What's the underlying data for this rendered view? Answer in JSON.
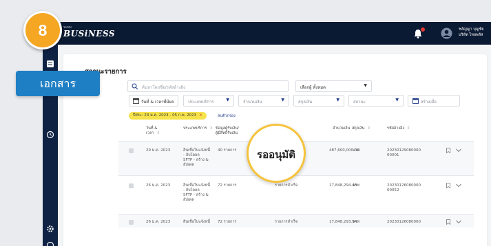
{
  "app": {
    "logo_prefix": "ระบบ",
    "logo": "BUSiNESS",
    "user_name_line1": "ชลัญญา บุญชัย",
    "user_name_line2": "บริษัท ไทยพลัส"
  },
  "badge": {
    "step_number": "8"
  },
  "annotation": {
    "menu_label": "เอกสาร",
    "callout_text": "รออนุมัติ"
  },
  "page": {
    "title": "สถานะรายการ"
  },
  "filters": {
    "search_placeholder": "ค้นหาโดยชื่อ/รหัสอ้างอิง",
    "account_select": "เลือกผู้ ทั้งหมด",
    "date_button": "วันที่ & เวลาที่มีผล",
    "service_type": "ประเภทบริการ",
    "amount": "จำนวนเงิน",
    "currency": "สกุลเงิน",
    "status": "สถานะ",
    "created_date": "สร้างเมื่อ",
    "active_chip": "ปีสระ: 23 ม.ค. 2023 - 05 ก.พ. 2023",
    "chip_close": "✕",
    "clear_label": "ลบตัวกรอง"
  },
  "table": {
    "headers": [
      "วันที่ &\nเวลา",
      "ประเภทบริการ",
      "ข้อมูลผู้รับเงิน/\nผู้มีสิทธิ์รับเงิน",
      "",
      "จำนวนเงิน",
      "สกุลเงิน",
      "รหัสอ้างอิง"
    ],
    "rows": [
      {
        "date": "29 ม.ค. 2023",
        "service": [
          "สินเชื่อใบแจ้งหนี้",
          "- ลับโดยล",
          "SFTP - สร้าง &",
          "อัปเดต"
        ],
        "payee": "40 รายการ",
        "status": "",
        "amount": "487,600,000.00",
        "currency": "บาท",
        "ref": [
          "20230129080000",
          "00001"
        ]
      },
      {
        "date": "26 ม.ค. 2023",
        "service": [
          "สินเชื่อใบแจ้งหนี้",
          "- ลับโดยล",
          "SFTP - สร้าง &",
          "อัปเดต"
        ],
        "payee": "72 รายการ",
        "status": "รายการสำเร็จ",
        "amount": "17,848,294.48",
        "currency": "บาท",
        "ref": [
          "20230126080000",
          "00052"
        ]
      },
      {
        "date": "26 ม.ค. 2023",
        "service": [
          "สินเชื่อใบแจ้งหนี้"
        ],
        "payee": "72 รายการ",
        "status": "รายการสำเร็จ",
        "amount": "17,848,293.94",
        "currency": "บาท",
        "ref": [
          "20230126080000"
        ]
      }
    ]
  },
  "colors": {
    "topbar": "#0b1a33",
    "accent_blue": "#1f7fc4",
    "badge_orange": "#f5a623",
    "chip_yellow": "#f6e34c"
  },
  "icons": [
    "search-icon",
    "calendar-icon",
    "bell-icon",
    "user-icon",
    "document-icon",
    "clock-icon",
    "settings-icon",
    "bookmark-icon",
    "chevron-down-icon"
  ]
}
